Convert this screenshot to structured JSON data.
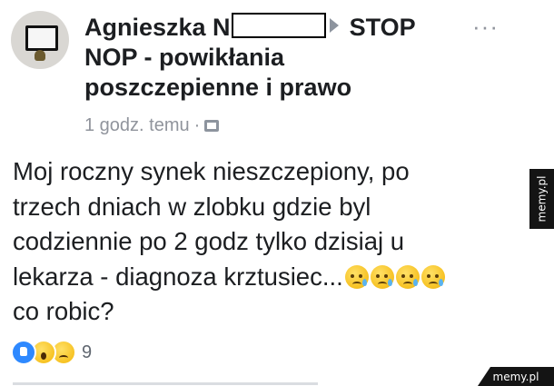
{
  "post": {
    "author_name": "Agnieszka N",
    "group_name_line1": "STOP",
    "group_name_line2": "NOP - powikłania",
    "group_name_line3": "poszczepienne i prawo",
    "timestamp": "1 godz. temu",
    "separator": "·",
    "privacy_icon": "photo-icon",
    "more_label": "···",
    "body_line1": "Moj roczny synek nieszczepiony, po",
    "body_line2": "trzech dniach w zlobku gdzie byl",
    "body_line3": "codziennie po 2 godz tylko dzisiaj u",
    "body_line4": "lekarza - diagnoza krztusiec...",
    "body_line5": "co robic?",
    "emoji_count": 4
  },
  "reactions": {
    "icons": [
      "like-icon",
      "wow-icon",
      "sad-icon"
    ],
    "count": "9"
  },
  "watermarks": {
    "side": "memy.pl",
    "bottom": "memy.pl"
  }
}
